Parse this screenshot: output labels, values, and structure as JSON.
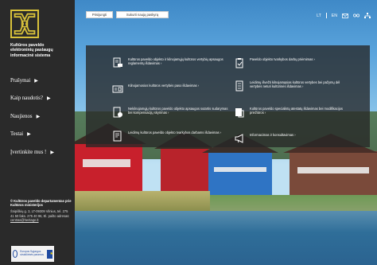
{
  "brand": {
    "lines": [
      "Kultūros paveldo",
      "elektroninių paslaugų",
      "informacinė sistema"
    ]
  },
  "nav": [
    {
      "label": "Prašymai"
    },
    {
      "label": "Kaip naudotis?"
    },
    {
      "label": "Naujienos"
    },
    {
      "label": "Testai"
    },
    {
      "label": "Įvertinkite mus !"
    }
  ],
  "footer": {
    "copyright": "© Kultūros paveldo departamentas prie Kultūros ministerijos",
    "address": "Šnipiškių g. 3, LT-09309 Vilnius, tel. 275 41 50 faks. 275 40 96, El. pašto adresas:",
    "email": "centras@heritage.lt"
  },
  "eu_logo": {
    "text": "Europos Sąjungos struktūrinės paramos"
  },
  "topbar": {
    "login": "Prisijungti",
    "register": "Sukurti naują paskyrą",
    "lang_lt": "LT",
    "lang_en": "EN"
  },
  "services": [
    {
      "icon": "document-stamp-icon",
      "label": "Kultūros paveldo objekto ir kilnojamųjų kultūros vertybių apsaugos reglamentų išdavimas ›"
    },
    {
      "icon": "clipboard-check-icon",
      "label": "Paveldo objekto tvarkybos darbų priėmimas ›"
    },
    {
      "icon": "certificate-icon",
      "label": "Kilnojamosios kultūros vertybės paso išdavimas ›"
    },
    {
      "icon": "checklist-icon",
      "label": "Leidimų išvežti kilnojamąsias kultūros vertybes bei pažymų dėl vertybės neturi kultūrinės išdavimas ›"
    },
    {
      "icon": "coin-document-icon",
      "label": "Nekilnojamųjų kultūros paveldo objekto apsaugos sutartis sudarymas bei kompensacijų skyrimas ›"
    },
    {
      "icon": "archive-document-icon",
      "label": "Kultūros paveldo specialistų atestatų išdavimas bei modifikacijos priežiūros ›"
    },
    {
      "icon": "permit-document-icon",
      "label": "Leidimų kultūros paveldo objekto tvarkybos darbams išdavimas ›"
    },
    {
      "icon": "megaphone-icon",
      "label": "Informacimas ir konsultavimas ›"
    }
  ],
  "colors": {
    "logo_gold": "#d9c23a",
    "panel": "#262626",
    "sidebar": "#2a2a2a"
  }
}
